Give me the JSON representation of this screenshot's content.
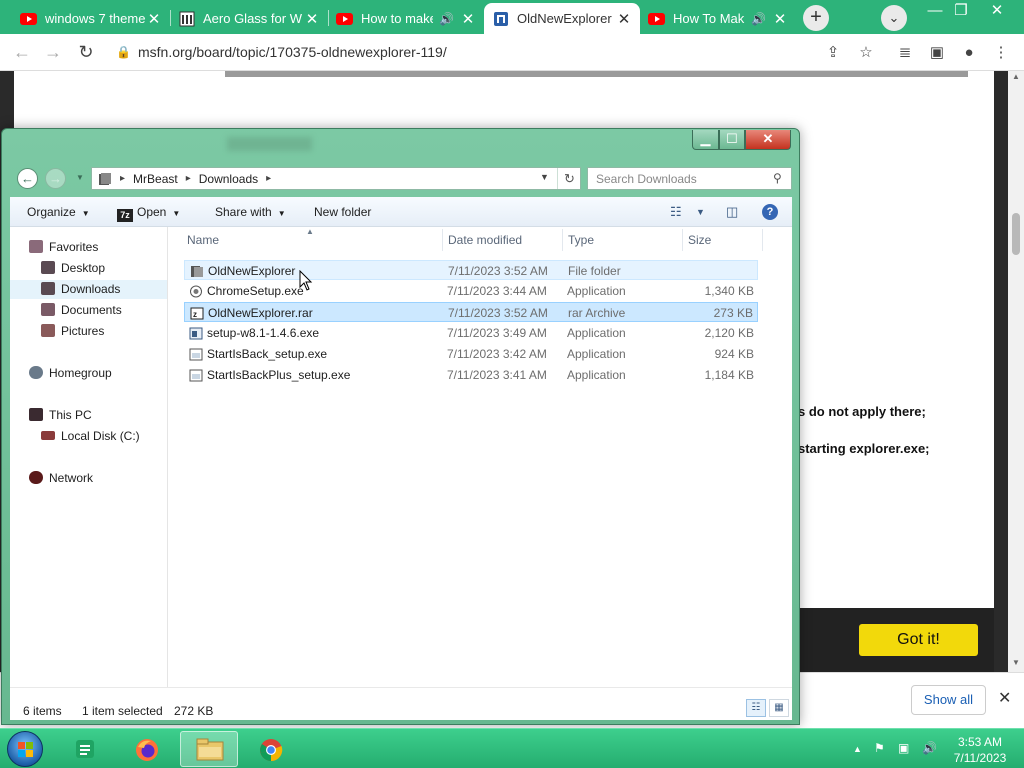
{
  "browser": {
    "tabs": [
      {
        "title": "windows 7 theme",
        "icon": "youtube-icon",
        "active": false,
        "audio": false
      },
      {
        "title": "Aero Glass for W",
        "icon": "site-favicon",
        "active": false,
        "audio": false
      },
      {
        "title": "How to make",
        "icon": "youtube-icon",
        "active": false,
        "audio": true
      },
      {
        "title": "OldNewExplorer",
        "icon": "msfn-favicon",
        "active": true,
        "audio": false
      },
      {
        "title": "How To Mak",
        "icon": "youtube-icon",
        "active": false,
        "audio": true
      }
    ],
    "new_tab_label": "+",
    "url": "msfn.org/board/topic/170375-oldnewexplorer-119/",
    "page": {
      "text1": "s do not apply there;",
      "text2": "starting explorer.exe;",
      "cookie_button": "Got it!"
    },
    "download_bar": {
      "show_all_label": "Show all",
      "close": "✕"
    }
  },
  "explorer": {
    "breadcrumb": [
      "MrBeast",
      "Downloads"
    ],
    "search_placeholder": "Search Downloads",
    "commands": {
      "organize": "Organize",
      "open": "Open",
      "share_with": "Share with",
      "new_folder": "New folder"
    },
    "nav": {
      "favorites": "Favorites",
      "desktop": "Desktop",
      "downloads": "Downloads",
      "documents": "Documents",
      "pictures": "Pictures",
      "homegroup": "Homegroup",
      "this_pc": "This PC",
      "local_disk": "Local Disk (C:)",
      "network": "Network"
    },
    "columns": {
      "name": "Name",
      "date": "Date modified",
      "type": "Type",
      "size": "Size"
    },
    "files": [
      {
        "name": "OldNewExplorer",
        "date": "7/11/2023 3:52 AM",
        "type": "File folder",
        "size": "",
        "icon": "folder-icon"
      },
      {
        "name": "ChromeSetup.exe",
        "date": "7/11/2023 3:44 AM",
        "type": "Application",
        "size": "1,340 KB",
        "icon": "installer-icon"
      },
      {
        "name": "OldNewExplorer.rar",
        "date": "7/11/2023 3:52 AM",
        "type": "rar Archive",
        "size": "273 KB",
        "icon": "archive-icon"
      },
      {
        "name": "setup-w8.1-1.4.6.exe",
        "date": "7/11/2023 3:49 AM",
        "type": "Application",
        "size": "2,120 KB",
        "icon": "setup-icon"
      },
      {
        "name": "StartIsBack_setup.exe",
        "date": "7/11/2023 3:42 AM",
        "type": "Application",
        "size": "924 KB",
        "icon": "app-icon"
      },
      {
        "name": "StartIsBackPlus_setup.exe",
        "date": "7/11/2023 3:41 AM",
        "type": "Application",
        "size": "1,184 KB",
        "icon": "app-icon"
      }
    ],
    "status": {
      "items": "6 items",
      "selected": "1 item selected",
      "selected_size": "272 KB"
    }
  },
  "taskbar": {
    "time": "3:53 AM",
    "date": "7/11/2023"
  },
  "colors": {
    "taskbar": "#2fb87a",
    "window_frame": "#7cc9a4",
    "selection": "#cce8ff",
    "cookie_button": "#f2d90b"
  }
}
